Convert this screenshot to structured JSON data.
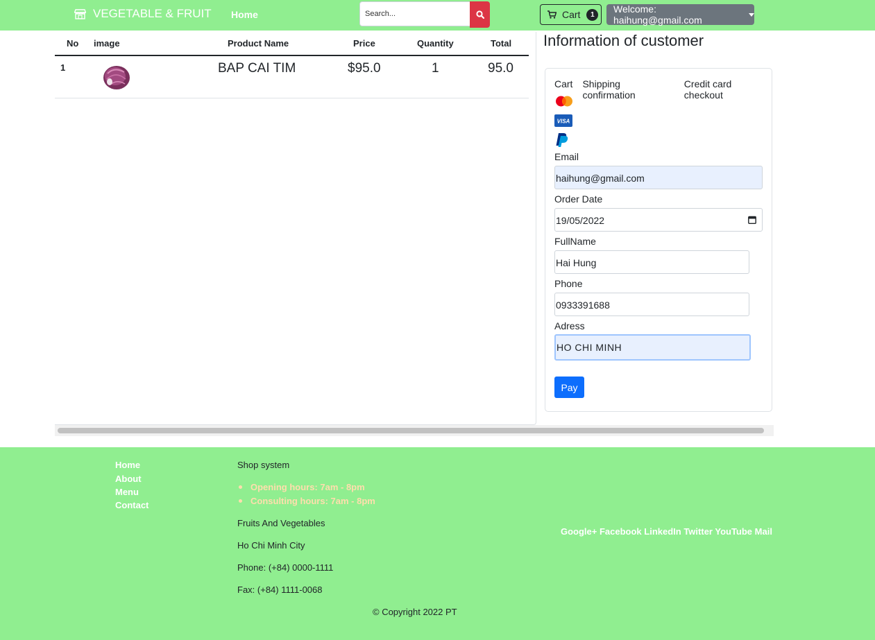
{
  "navbar": {
    "brand": "VEGETABLE & FRUIT",
    "home": "Home",
    "search_placeholder": "Search...",
    "cart_label": "Cart",
    "cart_count": "1",
    "user_label": "Welcome: haihung@gmail.com"
  },
  "table": {
    "headers": [
      "No",
      "image",
      "Product Name",
      "Price",
      "Quantity",
      "Total"
    ],
    "rows": [
      {
        "no": "1",
        "name": "BAP CAI TIM",
        "price": "$95.0",
        "quantity": "1",
        "total": "95.0"
      }
    ]
  },
  "customer": {
    "title": "Information of customer",
    "tabs": [
      "Cart",
      "Shipping confirmation",
      "Credit card checkout"
    ],
    "payment_icons": [
      "mastercard-icon",
      "visa-icon",
      "paypal-icon"
    ],
    "email_label": "Email",
    "email": "haihung@gmail.com",
    "date_label": "Order Date",
    "date": "19/05/2022",
    "fullname_label": "FullName",
    "fullname": "Hai Hung",
    "phone_label": "Phone",
    "phone": "0933391688",
    "address_label": "Adress",
    "address": "HO CHI MINH",
    "pay_button": "Pay"
  },
  "footer": {
    "links": [
      "Home",
      "About",
      "Menu",
      "Contact"
    ],
    "shop_title": "Shop system",
    "hours": [
      "Opening hours: 7am - 8pm",
      "Consulting hours: 7am - 8pm"
    ],
    "info": [
      "Fruits And Vegetables",
      "Ho Chi Minh City",
      "Phone: (+84) 0000-1111",
      "Fax: (+84) 1111-0068"
    ],
    "social": "Google+ Facebook LinkedIn Twitter YouTube Mail",
    "copyright": "© Copyright 2022 PT"
  },
  "colors": {
    "navbar_bg": "#90ee90",
    "footer_bg": "#90ee90",
    "search_button": "#dc3545",
    "pay_button": "#0d6efd",
    "user_button": "#6c757d",
    "hours_text": "#ffdead"
  }
}
